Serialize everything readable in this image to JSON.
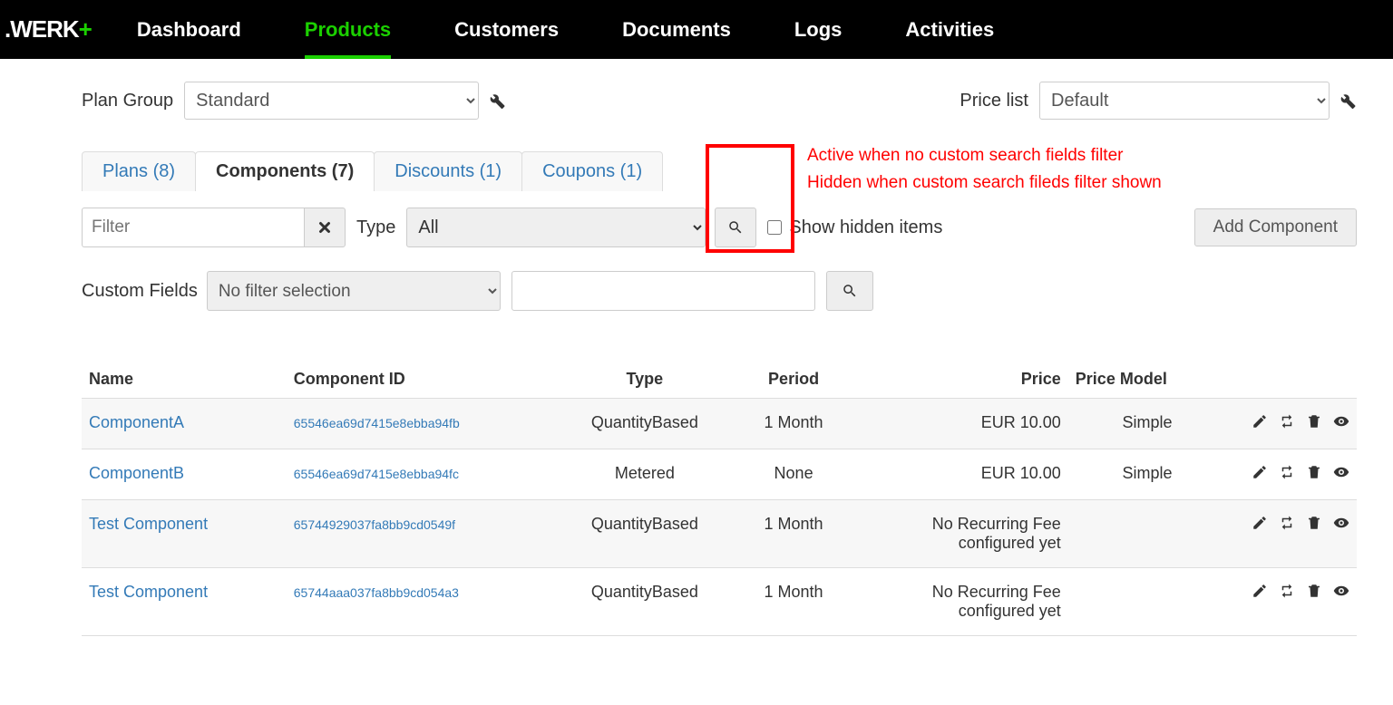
{
  "logo": {
    "brand": ".WERK",
    "plus": "+"
  },
  "nav": [
    "Dashboard",
    "Products",
    "Customers",
    "Documents",
    "Logs",
    "Activities"
  ],
  "nav_active": "Products",
  "header": {
    "plan_group_lbl": "Plan Group",
    "plan_group_value": "Standard",
    "price_list_lbl": "Price list",
    "price_list_value": "Default"
  },
  "tabs": [
    {
      "label": "Plans (8)",
      "active": false
    },
    {
      "label": "Components (7)",
      "active": true
    },
    {
      "label": "Discounts (1)",
      "active": false
    },
    {
      "label": "Coupons (1)",
      "active": false
    }
  ],
  "filter": {
    "placeholder": "Filter",
    "type_lbl": "Type",
    "type_value": "All",
    "show_hidden_lbl": "Show hidden items",
    "add_btn": "Add Component"
  },
  "annotations": {
    "line1": "Active when no custom search fields filter",
    "line2": "Hidden when custom search fileds filter shown"
  },
  "custom_fields": {
    "label": "Custom Fields",
    "select_value": "No filter selection"
  },
  "columns": [
    "Name",
    "Component ID",
    "Type",
    "Period",
    "Price",
    "Price Model"
  ],
  "rows": [
    {
      "name": "ComponentA",
      "id": "65546ea69d7415e8ebba94fb",
      "type": "QuantityBased",
      "period": "1 Month",
      "price": "EUR 10.00",
      "model": "Simple"
    },
    {
      "name": "ComponentB",
      "id": "65546ea69d7415e8ebba94fc",
      "type": "Metered",
      "period": "None",
      "price": "EUR 10.00",
      "model": "Simple"
    },
    {
      "name": "Test Component",
      "id": "65744929037fa8bb9cd0549f",
      "type": "QuantityBased",
      "period": "1 Month",
      "price": "No Recurring Fee configured yet",
      "model": ""
    },
    {
      "name": "Test Component",
      "id": "65744aaa037fa8bb9cd054a3",
      "type": "QuantityBased",
      "period": "1 Month",
      "price": "No Recurring Fee configured yet",
      "model": ""
    }
  ]
}
